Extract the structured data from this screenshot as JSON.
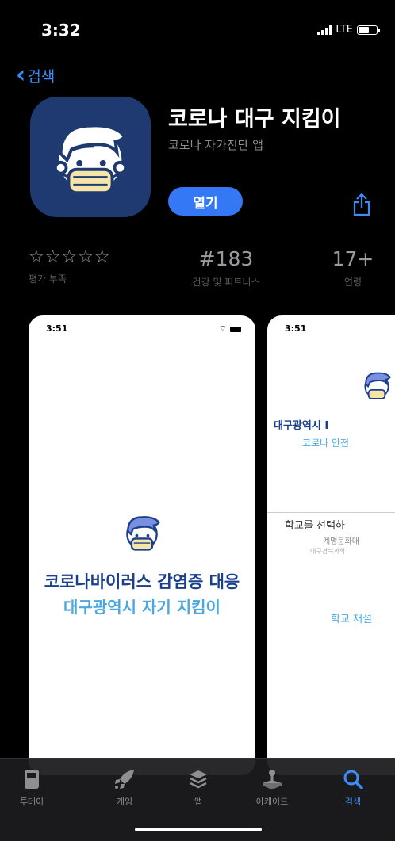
{
  "status_bar": {
    "time": "3:32",
    "network": "LTE",
    "battery_level": 0.6
  },
  "nav": {
    "back_label": "검색"
  },
  "app": {
    "title": "코로나 대구 지킴이",
    "subtitle": "코로나 자가진단 앱",
    "open_label": "열기",
    "icon": "masked-face-icon"
  },
  "stats": {
    "rating_stars": "☆☆☆☆☆",
    "rating_label": "평가 부족",
    "rank": "#183",
    "rank_label": "건강 및 피트니스",
    "age": "17+",
    "age_label": "연령"
  },
  "screenshots": [
    {
      "time": "3:51",
      "line1": "코로나바이러스 감염증 대응",
      "line2": "대구광역시 자기 지킴이"
    },
    {
      "time": "3:51",
      "title1": "대구광역시 I",
      "title2": "코로나 안전",
      "select_label": "학교를 선택하",
      "sub1": "계명문화대",
      "sub2": "대구경북과학",
      "reselect": "학교 재설"
    }
  ],
  "tabs": [
    {
      "label": "투데이",
      "icon": "today-icon"
    },
    {
      "label": "게임",
      "icon": "rocket-icon"
    },
    {
      "label": "앱",
      "icon": "apps-stack-icon"
    },
    {
      "label": "아케이드",
      "icon": "arcade-joystick-icon"
    },
    {
      "label": "검색",
      "icon": "search-icon",
      "active": true
    }
  ],
  "colors": {
    "accent": "#3478f6",
    "icon_bg": "#1e3a70",
    "brand_dark_blue": "#1a3f8c",
    "brand_light_blue": "#4aa8e0"
  }
}
